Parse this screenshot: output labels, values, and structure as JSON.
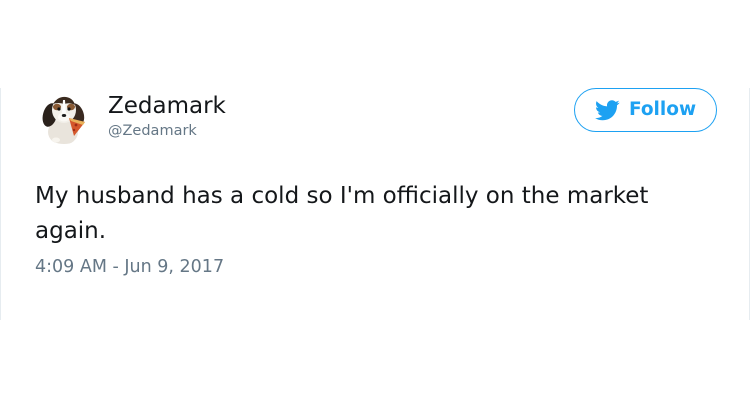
{
  "tweet": {
    "author_name": "Zedamark",
    "author_handle": "@Zedamark",
    "avatar_icon": "beagle-puppy-avatar",
    "follow_label": "Follow",
    "follow_icon": "twitter-bird-icon",
    "text": "My husband has a cold so I'm officially on the market again.",
    "timestamp": "4:09 AM - Jun 9, 2017"
  },
  "colors": {
    "accent": "#1da1f2",
    "text_primary": "#14171a",
    "text_secondary": "#657786"
  }
}
